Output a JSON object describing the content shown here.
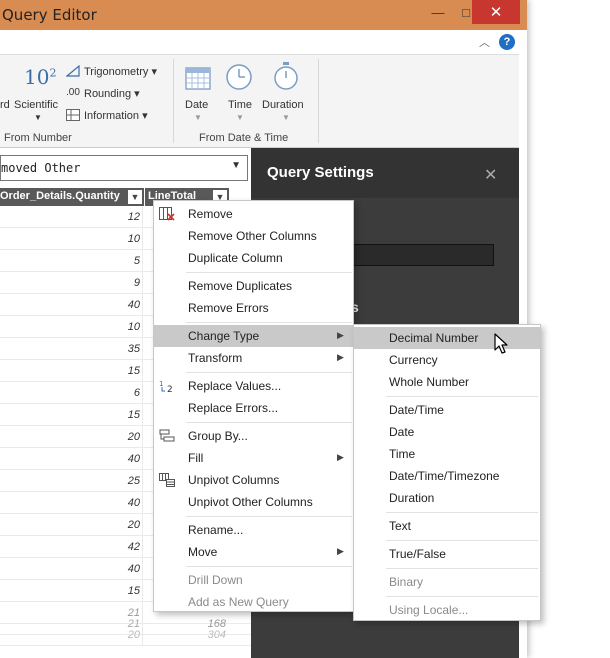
{
  "window": {
    "title": "Query Editor",
    "min": "—",
    "max": "□",
    "close": "✕",
    "help": "?"
  },
  "ribbon": {
    "number": {
      "standard_partial": "rd",
      "scientific_base": "10",
      "scientific_exp": "2",
      "scientific": "Scientific",
      "trigonometry": "Trigonometry",
      "rounding": "Rounding",
      "rounding_icon_text": ".00",
      "information": "Information",
      "group": "From Number"
    },
    "datetime": {
      "date": "Date",
      "time": "Time",
      "duration": "Duration",
      "group": "From Date & Time"
    }
  },
  "formula": {
    "text": "moved Other"
  },
  "columns": [
    {
      "label": "Order_Details.Quantity"
    },
    {
      "label": "LineTotal"
    }
  ],
  "rows": [
    {
      "q": "12",
      "t": ""
    },
    {
      "q": "10",
      "t": ""
    },
    {
      "q": "5",
      "t": ""
    },
    {
      "q": "9",
      "t": ""
    },
    {
      "q": "40",
      "t": ""
    },
    {
      "q": "10",
      "t": ""
    },
    {
      "q": "35",
      "t": ""
    },
    {
      "q": "15",
      "t": ""
    },
    {
      "q": "6",
      "t": ""
    },
    {
      "q": "15",
      "t": ""
    },
    {
      "q": "20",
      "t": ""
    },
    {
      "q": "40",
      "t": ""
    },
    {
      "q": "25",
      "t": ""
    },
    {
      "q": "40",
      "t": ""
    },
    {
      "q": "20",
      "t": ""
    },
    {
      "q": "42",
      "t": ""
    },
    {
      "q": "40",
      "t": ""
    },
    {
      "q": "15",
      "t": ""
    },
    {
      "q": "21",
      "t": ""
    },
    {
      "q": "21",
      "t": "168"
    },
    {
      "q": "20",
      "t": "304"
    }
  ],
  "query_settings": {
    "title": "Query Settings",
    "close": "✕",
    "partial_heading": "s"
  },
  "context_menu": {
    "items": [
      {
        "label": "Remove"
      },
      {
        "label": "Remove Other Columns"
      },
      {
        "label": "Duplicate Column"
      },
      {
        "label": "Remove Duplicates"
      },
      {
        "label": "Remove Errors"
      },
      {
        "label": "Change Type",
        "arrow": "▶"
      },
      {
        "label": "Transform",
        "arrow": "▶"
      },
      {
        "label": "Replace Values..."
      },
      {
        "label": "Replace Errors..."
      },
      {
        "label": "Group By..."
      },
      {
        "label": "Fill",
        "arrow": "▶"
      },
      {
        "label": "Unpivot Columns"
      },
      {
        "label": "Unpivot Other Columns"
      },
      {
        "label": "Rename..."
      },
      {
        "label": "Move",
        "arrow": "▶"
      },
      {
        "label": "Drill Down"
      },
      {
        "label": "Add as New Query"
      }
    ]
  },
  "type_submenu": {
    "items": [
      {
        "label": "Decimal Number"
      },
      {
        "label": "Currency"
      },
      {
        "label": "Whole Number"
      },
      {
        "label": "Date/Time"
      },
      {
        "label": "Date"
      },
      {
        "label": "Time"
      },
      {
        "label": "Date/Time/Timezone"
      },
      {
        "label": "Duration"
      },
      {
        "label": "Text"
      },
      {
        "label": "True/False"
      },
      {
        "label": "Binary"
      },
      {
        "label": "Using Locale..."
      }
    ]
  },
  "colors": {
    "titlebar": "#d98c52",
    "close": "#c7372f",
    "header": "#595959",
    "highlight": "#c9c9c9",
    "settings_bg": "#3c3c3c"
  }
}
